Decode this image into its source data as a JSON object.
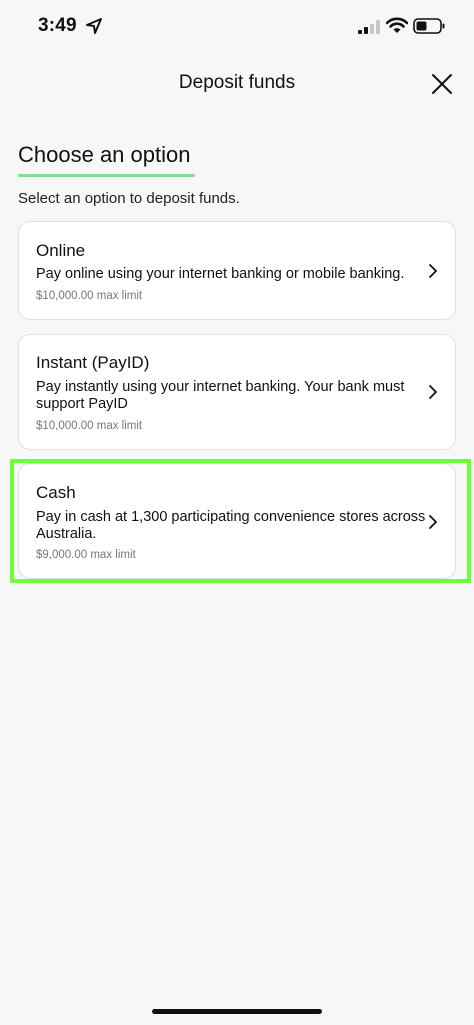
{
  "status_bar": {
    "time": "3:49",
    "icons": [
      "location-arrow-icon",
      "cellular-signal-icon",
      "wifi-icon",
      "battery-icon"
    ]
  },
  "header": {
    "title": "Deposit funds",
    "close_icon": "close-icon"
  },
  "section": {
    "title": "Choose an option",
    "subtitle": "Select an option to deposit funds.",
    "accent_color": "#7ee08a"
  },
  "options": [
    {
      "title": "Online",
      "description": "Pay online using your internet banking or mobile banking.",
      "limit": "$10,000.00 max limit"
    },
    {
      "title": "Instant (PayID)",
      "description": "Pay instantly using your internet banking. Your bank must support PayID",
      "limit": "$10,000.00 max limit"
    },
    {
      "title": "Cash",
      "description": "Pay in cash at 1,300 participating convenience stores across Australia.",
      "limit": "$9,000.00 max limit"
    }
  ],
  "highlight_color": "#6dff3a"
}
